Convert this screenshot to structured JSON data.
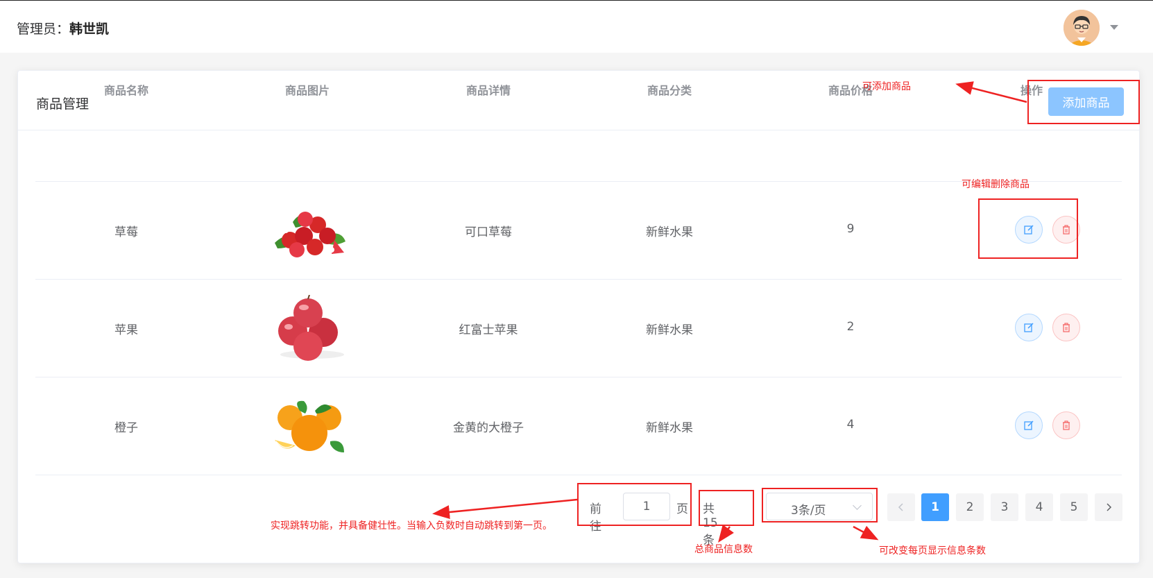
{
  "header": {
    "admin_label": "管理员：",
    "admin_name": "韩世凯"
  },
  "card": {
    "title": "商品管理",
    "add_button": "添加商品"
  },
  "table": {
    "columns": [
      "商品名称",
      "商品图片",
      "商品详情",
      "商品分类",
      "商品价格",
      "操作"
    ],
    "rows": [
      {
        "name": "草莓",
        "image": "strawberry-image",
        "detail": "可口草莓",
        "category": "新鲜水果",
        "price": "9"
      },
      {
        "name": "苹果",
        "image": "apple-image",
        "detail": "红富士苹果",
        "category": "新鲜水果",
        "price": "2"
      },
      {
        "name": "橙子",
        "image": "orange-image",
        "detail": "金黄的大橙子",
        "category": "新鲜水果",
        "price": "4"
      }
    ],
    "edit_icon": "edit-icon",
    "delete_icon": "trash-icon"
  },
  "pagination": {
    "goto_prefix": "前往",
    "goto_value": "1",
    "goto_suffix": "页",
    "total": "共 15 条",
    "page_size": "3条/页",
    "pages": [
      "1",
      "2",
      "3",
      "4",
      "5"
    ],
    "current_page": "1"
  },
  "annotations": {
    "add_note": "可添加商品",
    "edit_note": "可编辑删除商品",
    "goto_note": "实现跳转功能，并具备健壮性。当输入负数时自动跳转到第一页。",
    "total_note": "总商品信息数",
    "size_note": "可改变每页显示信息条数"
  },
  "colors": {
    "primary": "#409eff",
    "primary_light": "#8cc5ff",
    "danger": "#f56c6c",
    "annotation_red": "#e22"
  }
}
